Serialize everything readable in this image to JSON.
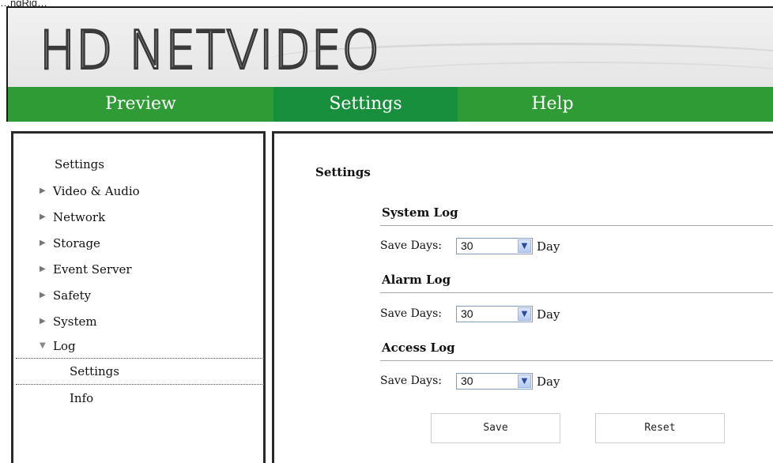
{
  "window_title_fragment": "…ngRig…",
  "banner": {
    "logo_text": "HD NETVIDEO"
  },
  "nav": {
    "preview": "Preview",
    "settings": "Settings",
    "help": "Help"
  },
  "sidebar": {
    "header": "Settings",
    "items": [
      {
        "label": "Video & Audio",
        "expanded": false
      },
      {
        "label": "Network",
        "expanded": false
      },
      {
        "label": "Storage",
        "expanded": false
      },
      {
        "label": "Event Server",
        "expanded": false
      },
      {
        "label": "Safety",
        "expanded": false
      },
      {
        "label": "System",
        "expanded": false
      },
      {
        "label": "Log",
        "expanded": true
      }
    ],
    "log_sub": [
      {
        "label": "Settings",
        "selected": true
      },
      {
        "label": "Info",
        "selected": false
      }
    ]
  },
  "content": {
    "title": "Settings",
    "sections": [
      {
        "title": "System Log",
        "label": "Save Days:",
        "value": "30",
        "unit": "Day"
      },
      {
        "title": "Alarm Log",
        "label": "Save Days:",
        "value": "30",
        "unit": "Day"
      },
      {
        "title": "Access Log",
        "label": "Save Days:",
        "value": "30",
        "unit": "Day"
      }
    ],
    "save_label": "Save",
    "reset_label": "Reset"
  },
  "colors": {
    "nav_green": "#2e9b35",
    "nav_active": "#178f3c"
  }
}
